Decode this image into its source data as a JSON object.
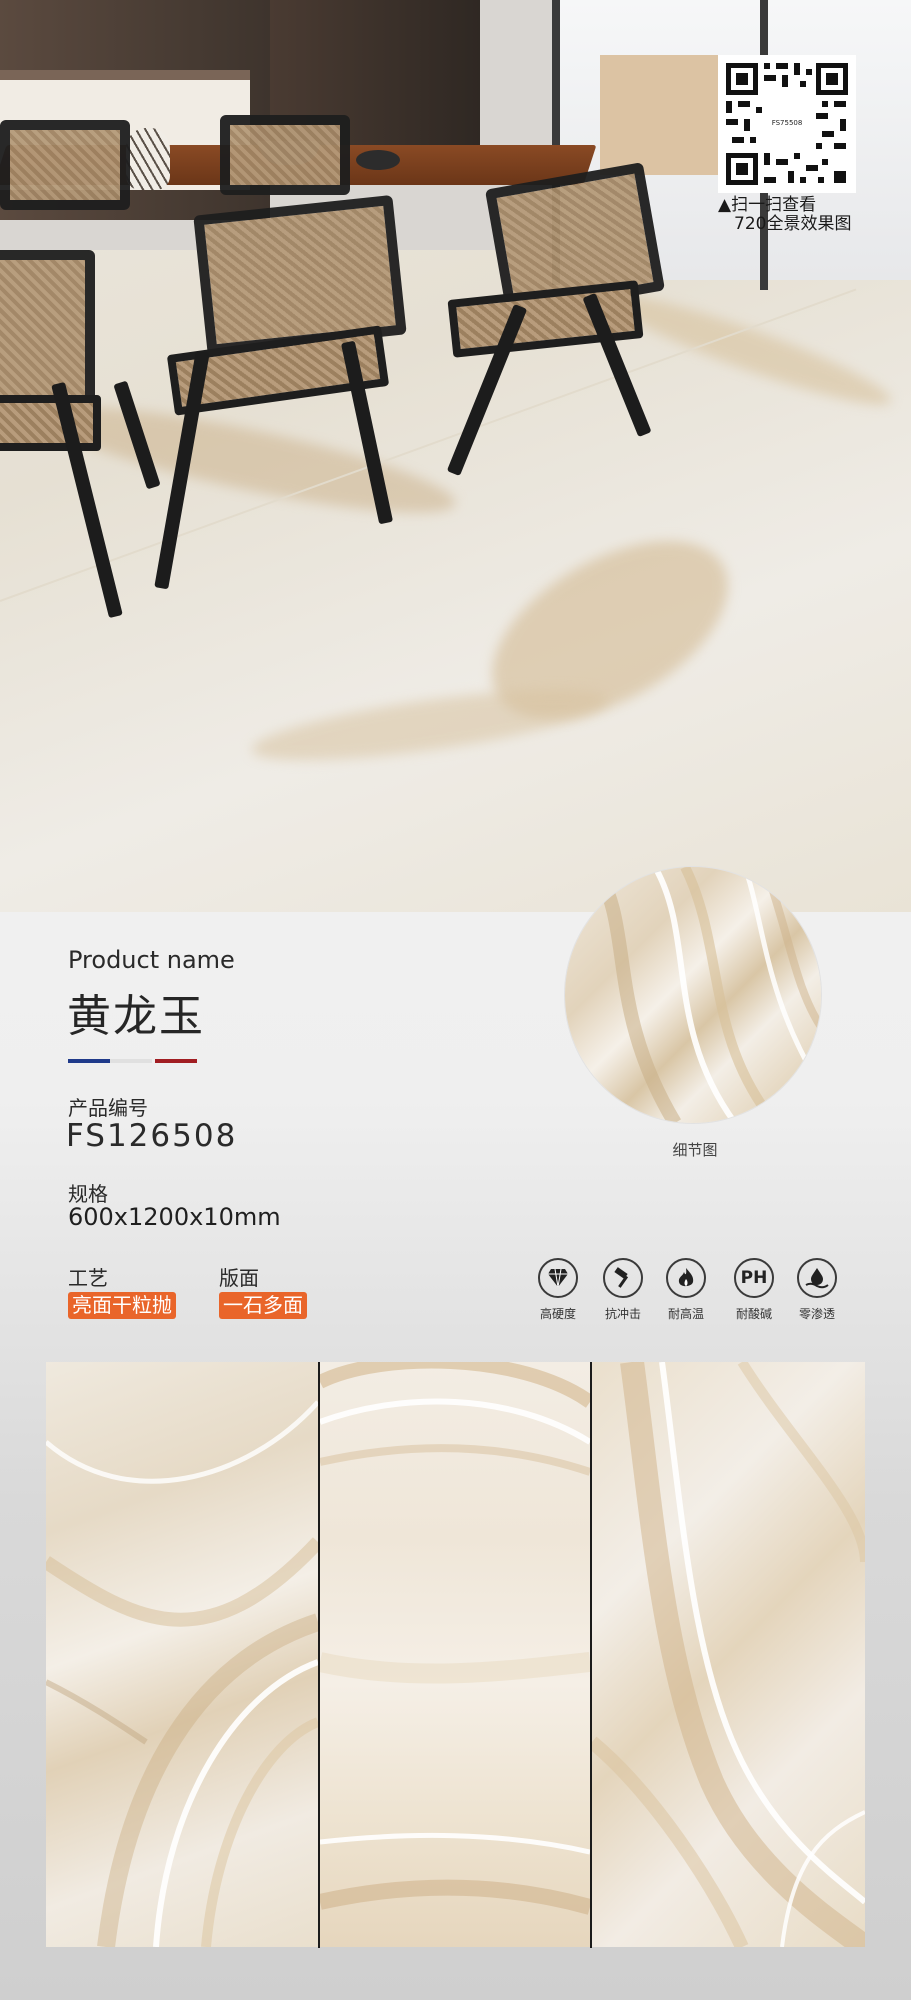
{
  "qr": {
    "code_text": "FS75508",
    "caption_line1": "▲扫一扫查看",
    "caption_line2": "720全景效果图"
  },
  "product": {
    "name_label": "Product name",
    "name": "黄龙玉",
    "code_label": "产品编号",
    "code": "FS126508",
    "spec_label": "规格",
    "spec": "600x1200x10mm",
    "craft_label": "工艺",
    "craft_value": "亮面干粒抛",
    "face_label": "版面",
    "face_value": "一石多面"
  },
  "detail": {
    "label": "细节图"
  },
  "features": [
    {
      "icon": "diamond-icon",
      "label": "高硬度"
    },
    {
      "icon": "hammer-icon",
      "label": "抗冲击"
    },
    {
      "icon": "flame-icon",
      "label": "耐高温"
    },
    {
      "icon": "ph-icon",
      "symbol": "PH",
      "label": "耐酸碱"
    },
    {
      "icon": "water-drop-icon",
      "label": "零渗透"
    }
  ],
  "colors": {
    "accent_orange": "#e9652a",
    "flag_blue": "#1f3a8a",
    "flag_white": "#e0e0e0",
    "flag_red": "#a11d22"
  }
}
